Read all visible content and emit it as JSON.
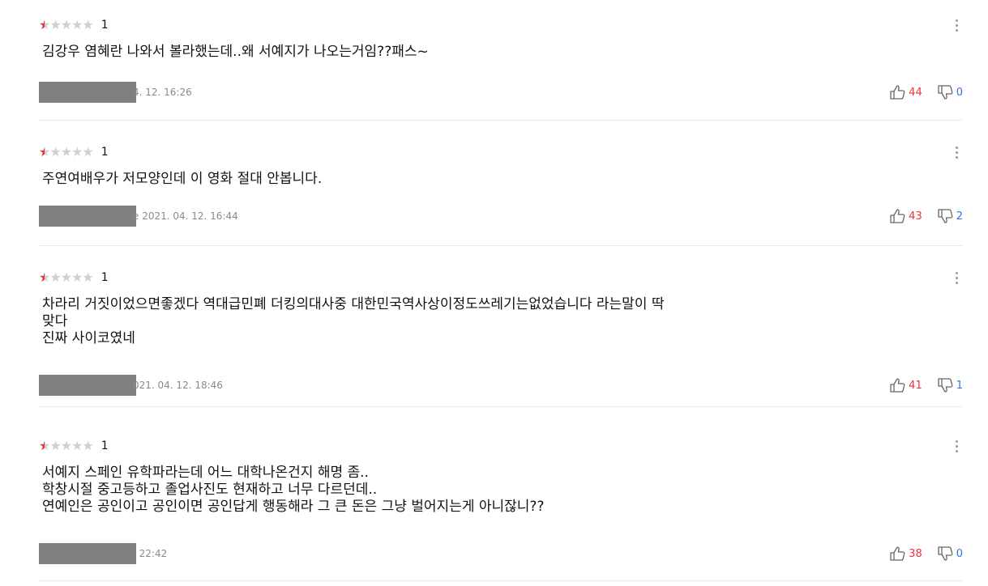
{
  "reviews": [
    {
      "rating_text": "1",
      "rating_fraction": 0.1,
      "text": "김강우 염혜란 나와서 볼라했는데..왜 서예지가 나오는거임??패스~",
      "date_visible": "4. 12. 16:26",
      "likes": "44",
      "dislikes": "0"
    },
    {
      "rating_text": "1",
      "rating_fraction": 0.1,
      "text": "주연여배우가 저모양인데 이 영화 절대 안봅니다.",
      "date_visible": "e 2021. 04. 12. 16:44",
      "likes": "43",
      "dislikes": "2"
    },
    {
      "rating_text": "1",
      "rating_fraction": 0.1,
      "text": "차라리 거짓이었으면좋겠다 역대급민폐  더킹의대사중 대한민국역사상이정도쓰레기는없었습니다 라는말이 딱\n맞다\n진짜 사이코였네",
      "date_visible": "021. 04. 12. 18:46",
      "likes": "41",
      "dislikes": "1"
    },
    {
      "rating_text": "1",
      "rating_fraction": 0.1,
      "text": "서예지 스페인 유학파라는데 어느 대학나온건지 해명 좀..\n학창시절 중고등하고 졸업사진도 현재하고 너무 다르던데..\n연예인은 공인이고 공인이면 공인답게 행동해라 그 큰 돈은 그냥 벌어지는게 아니잖니??",
      "date_visible": ". 22:42",
      "likes": "38",
      "dislikes": "0"
    }
  ],
  "colors": {
    "star_filled": "#e8343a",
    "star_empty": "#d0d0d0",
    "like": "#e8343a",
    "dislike": "#3a6fd8",
    "mask": "#808080"
  },
  "icons": {
    "like": "thumbs-up-icon",
    "dislike": "thumbs-down-icon",
    "more": "more-vertical-icon"
  }
}
